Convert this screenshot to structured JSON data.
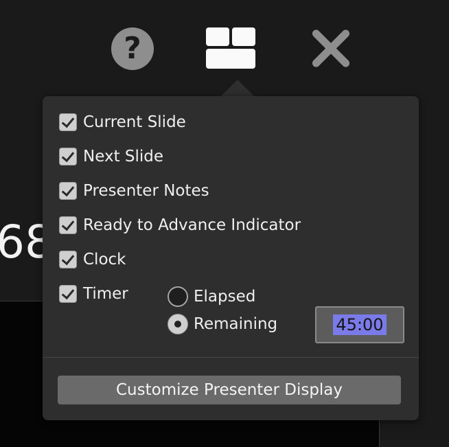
{
  "background": {
    "partial_number": "68"
  },
  "toolbar": {
    "help_symbol": "?",
    "icons": [
      "help-icon",
      "layout-icon",
      "close-icon"
    ]
  },
  "popover": {
    "options": [
      {
        "label": "Current Slide",
        "checked": true
      },
      {
        "label": "Next Slide",
        "checked": true
      },
      {
        "label": "Presenter Notes",
        "checked": true
      },
      {
        "label": "Ready to Advance Indicator",
        "checked": true
      },
      {
        "label": "Clock",
        "checked": true
      },
      {
        "label": "Timer",
        "checked": true
      }
    ],
    "timer_modes": [
      {
        "label": "Elapsed",
        "selected": false
      },
      {
        "label": "Remaining",
        "selected": true
      }
    ],
    "timer_value": "45:00",
    "customize_button": "Customize Presenter Display"
  },
  "colors": {
    "popover_bg": "#2e2e2e",
    "selection_highlight": "#7a7ae8",
    "button_bg": "#6a6a6a"
  }
}
